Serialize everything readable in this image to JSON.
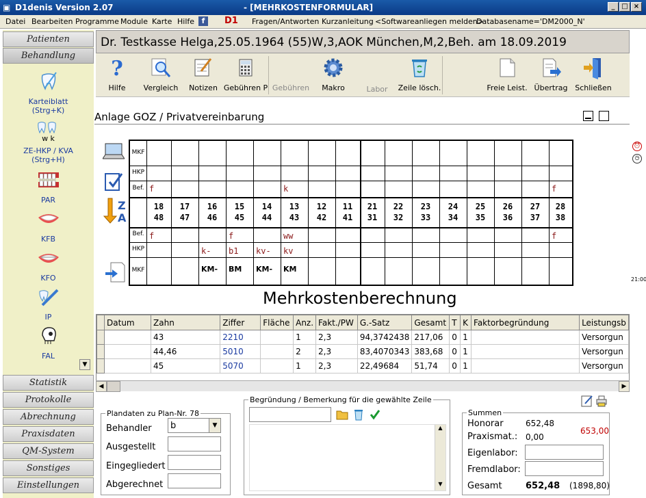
{
  "window": {
    "title": "D1denis Version 2.07",
    "subtitle": "- [MEHRKOSTENFORMULAR]",
    "d1_logo": "D1"
  },
  "menu": {
    "items": [
      "Datei",
      "Bearbeiten",
      "Programme",
      "Module",
      "Karte",
      "Hilfe"
    ],
    "extra": [
      "Fragen/Antworten",
      "Kurzanleitung",
      "<Softwareanliegen melden>",
      "Databasename='DM2000_N'"
    ]
  },
  "sidebar": {
    "top_buttons": [
      "Patienten",
      "Behandlung"
    ],
    "items": [
      {
        "label": "Karteiblatt\n(Strg+K)",
        "icon": "tooth-brush-icon"
      },
      {
        "label": "w  k",
        "icon": "teeth-pair-icon"
      },
      {
        "label": "ZE-HKP / KVA\n(Strg+H)",
        "icon": "dental-chart-icon"
      },
      {
        "label": "PAR",
        "icon": "gums-icon"
      },
      {
        "label": "KFB",
        "icon": "smile-icon"
      },
      {
        "label": "KFO",
        "icon": "braces-smile-icon"
      },
      {
        "label": "IP",
        "icon": "toothbrush-icon"
      },
      {
        "label": "FAL",
        "icon": "skull-icon"
      }
    ],
    "bottom_buttons": [
      "Statistik",
      "Protokolle",
      "Abrechnung",
      "Praxisdaten",
      "QM-System",
      "Sonstiges",
      "Einstellungen"
    ]
  },
  "patient_line": "Dr. Testkasse Helga,25.05.1964 (55)W,3,AOK München,M,2,Beh. am 18.09.2019",
  "toolbar": {
    "buttons": [
      {
        "label": "Hilfe",
        "icon": "question-icon",
        "enabled": true
      },
      {
        "label": "Vergleich",
        "icon": "magnifier-icon",
        "enabled": true
      },
      {
        "label": "Notizen",
        "icon": "notepad-icon",
        "enabled": true
      },
      {
        "label": "Gebühren P",
        "icon": "calculator-icon",
        "enabled": true
      },
      {
        "label": "Gebühren",
        "icon": "blank",
        "enabled": false
      },
      {
        "label": "Makro",
        "icon": "gear-icon",
        "enabled": true
      },
      {
        "label": "Labor",
        "icon": "blank",
        "enabled": false
      },
      {
        "label": "Zeile lösch.",
        "icon": "recycle-bin-icon",
        "enabled": true
      },
      {
        "label": "Freie Leist.",
        "icon": "blank-page-icon",
        "enabled": true
      },
      {
        "label": "Übertrag",
        "icon": "document-arrow-icon",
        "enabled": true
      },
      {
        "label": "Schließen",
        "icon": "exit-door-icon",
        "enabled": true
      }
    ]
  },
  "section": {
    "title": "Anlage GOZ / Privatvereinbarung"
  },
  "right_clock": "21:00",
  "tooth_grid": {
    "row_labels_upper": [
      "MKF",
      "HKP",
      "Bef."
    ],
    "row_labels_lower": [
      "Bef.",
      "HKP",
      "MKF"
    ],
    "upper_numbers": [
      "18",
      "17",
      "16",
      "15",
      "14",
      "13",
      "12",
      "11",
      "21",
      "22",
      "23",
      "24",
      "25",
      "26",
      "27",
      "28"
    ],
    "lower_numbers": [
      "48",
      "47",
      "46",
      "45",
      "44",
      "43",
      "42",
      "41",
      "31",
      "32",
      "33",
      "34",
      "35",
      "36",
      "37",
      "38"
    ],
    "upper_bef": {
      "0": "f",
      "5": "k",
      "15": "f"
    },
    "lower_bef": {
      "0": "f",
      "3": "f",
      "5": "ww",
      "15": "f"
    },
    "lower_hkp": {
      "2": "k-",
      "3": "b1",
      "4": "kv-",
      "5": "kv"
    },
    "lower_mkf": {
      "2": "KM-",
      "3": "BM",
      "4": "KM-",
      "5": "KM"
    }
  },
  "calc_heading": "Mehrkostenberechnung",
  "table": {
    "columns": [
      "Datum",
      "Zahn",
      "Ziffer",
      "Fläche",
      "Anz.",
      "Fakt./PW",
      "G.-Satz",
      "Gesamt",
      "T",
      "K",
      "Faktorbegründung",
      "Leistungsb"
    ],
    "rows": [
      [
        "",
        "43",
        "2210",
        "",
        "1",
        "2,3",
        "94,3742438",
        "217,06",
        "0",
        "1",
        "",
        "Versorgun"
      ],
      [
        "",
        "44,46",
        "5010",
        "",
        "2",
        "2,3",
        "83,4070343",
        "383,68",
        "0",
        "1",
        "",
        "Versorgun"
      ],
      [
        "",
        "45",
        "5070",
        "",
        "1",
        "2,3",
        "22,49684",
        "51,74",
        "0",
        "1",
        "",
        "Versorgun"
      ]
    ]
  },
  "plandaten": {
    "legend": "Plandaten zu Plan-Nr. 78",
    "labels": [
      "Behandler",
      "Ausgestellt",
      "Eingegliedert",
      "Abgerechnet"
    ],
    "behandler_value": "b"
  },
  "begruendung": {
    "legend": "Begründung / Bemerkung für die gewählte Zeile"
  },
  "summen": {
    "legend": "Summen",
    "honorar_label": "Honorar",
    "honorar_value": "652,48",
    "praxismat_label": "Praxismat.:",
    "praxismat_value": "0,00",
    "red_total": "653,00",
    "eigenlabor_label": "Eigenlabor:",
    "fremdlabor_label": "Fremdlabor:",
    "gesamt_label": "Gesamt",
    "gesamt_value": "652,48",
    "gesamt_paren": "(1898,80)"
  },
  "colors": {
    "title_bar": "#0a3a86",
    "sidebar_bg": "#f0f0c8",
    "link_blue": "#1a3aa0",
    "red": "#c00000",
    "tooth_note": "#8b1a1a"
  }
}
